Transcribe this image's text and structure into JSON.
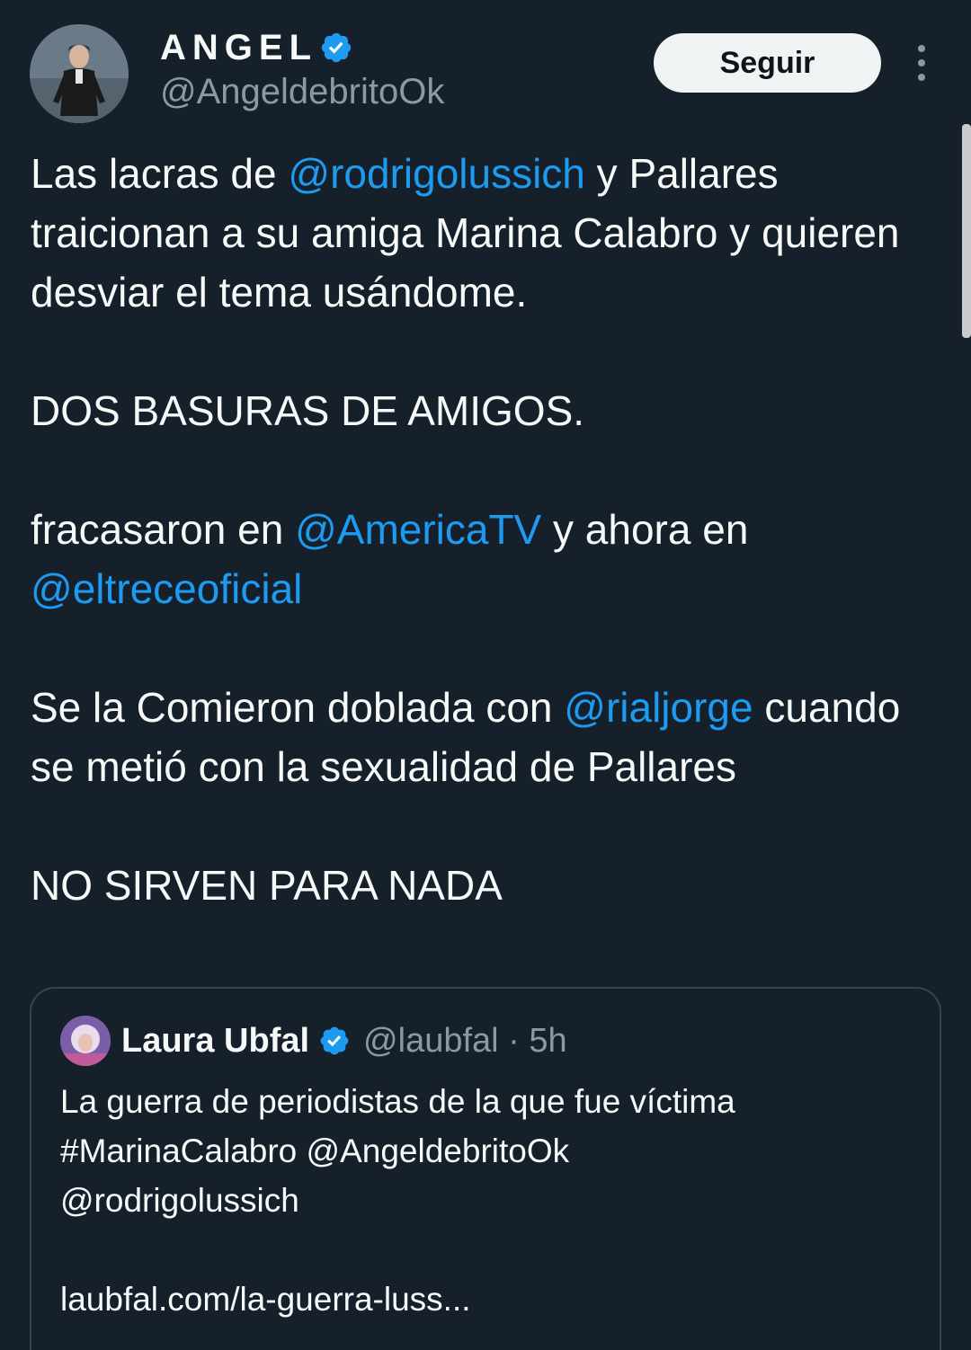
{
  "author": {
    "name": "ANGEL",
    "handle": "@AngeldebritoOk",
    "avatar_icon": "user-avatar",
    "verified_icon": "verified-badge-icon",
    "verified_color": "#1d9bf0"
  },
  "follow_label": "Seguir",
  "more_icon": "more-vertical-icon",
  "tweet": {
    "p1": {
      "t1": "Las lacras de ",
      "m1": "@rodrigolussich",
      "t2": " y Pallares traicionan a su amiga Marina Calabro y quieren desviar el tema usándome."
    },
    "p2": "DOS BASURAS DE AMIGOS.",
    "p3": {
      "t1": "fracasaron en ",
      "m1": "@AmericaTV",
      "t2": " y ahora en ",
      "m2": "@eltreceoficial"
    },
    "p4": {
      "t1": "Se la Comieron doblada con ",
      "m1": "@rialjorge",
      "t2": " cuando se metió con la sexualidad de Pallares"
    },
    "p5": "NO SIRVEN PARA NADA"
  },
  "quoted": {
    "name": "Laura Ubfal",
    "handle": "@laubfal",
    "separator": "·",
    "time": "5h",
    "line1": "La guerra de periodistas de la que fue víctima",
    "line2": "#MarinaCalabro @AngeldebritoOk",
    "line3": "@rodrigolussich",
    "link": "laubfal.com/la-guerra-luss..."
  },
  "colors": {
    "background": "#15202b",
    "text": "#f7f9f9",
    "secondary": "#8b98a5",
    "link": "#1d9bf0",
    "border": "#38444d"
  }
}
